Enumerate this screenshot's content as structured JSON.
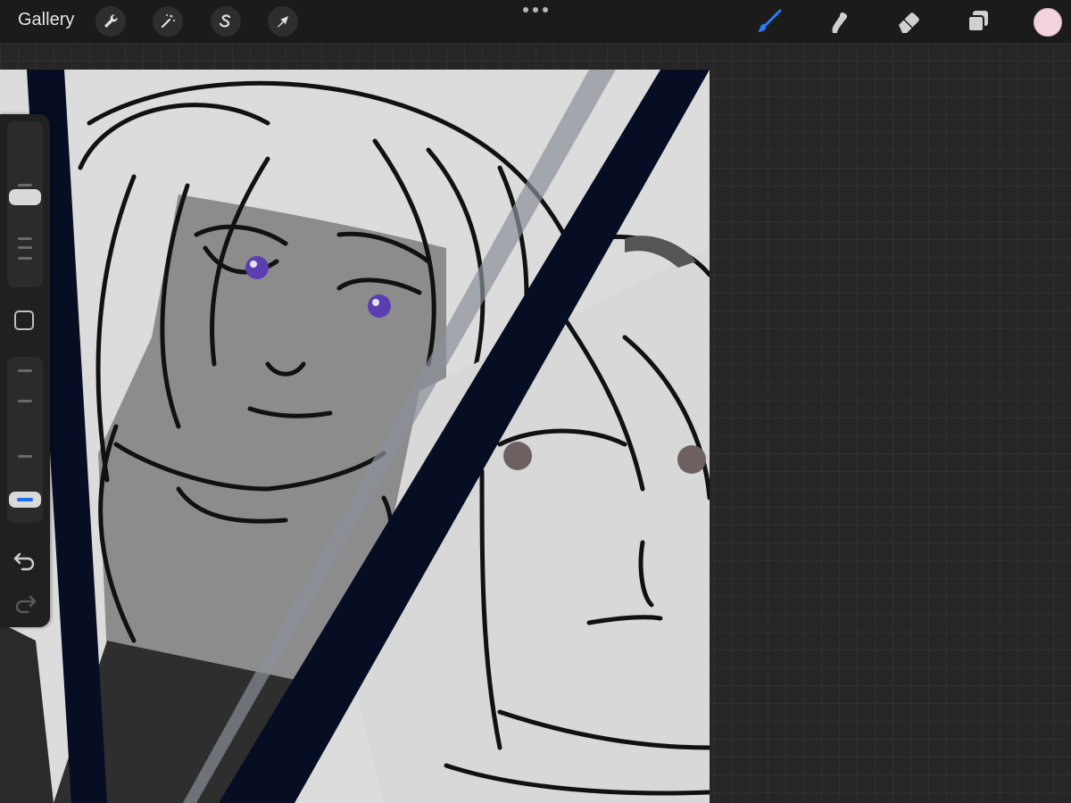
{
  "topbar": {
    "gallery_label": "Gallery",
    "left_tools": [
      "wrench-icon",
      "magic-wand-icon",
      "selection-s-icon",
      "transform-arrow-icon"
    ],
    "right_tools": [
      "brush-icon",
      "smudge-icon",
      "eraser-icon",
      "layers-icon"
    ],
    "active_tool": "brush-icon",
    "more_menu": "three-dots-icon",
    "current_color": "#f3d4dc",
    "accent_color": "#1c6df0"
  },
  "sidebar": {
    "brush_size_slider": {
      "level": 0.55
    },
    "opacity_slider": {
      "level": 0.1
    },
    "modify_button": "square-icon",
    "undo": "undo-arrow-icon",
    "redo": "redo-arrow-icon"
  },
  "canvas": {
    "content": "sketch"
  }
}
